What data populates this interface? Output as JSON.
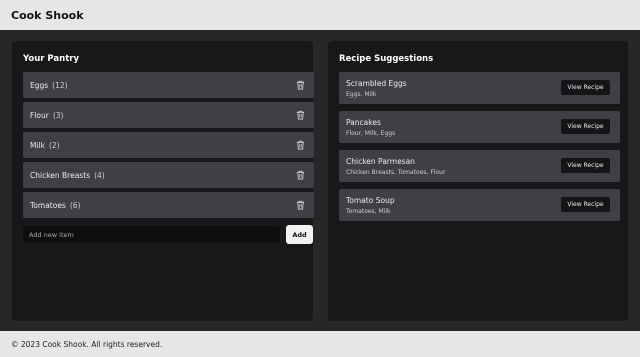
{
  "app": {
    "title": "Cook Shook"
  },
  "pantry": {
    "title": "Your Pantry",
    "items": [
      {
        "name": "Eggs",
        "qty": "(12)"
      },
      {
        "name": "Flour",
        "qty": "(3)"
      },
      {
        "name": "Milk",
        "qty": "(2)"
      },
      {
        "name": "Chicken Breasts",
        "qty": "(4)"
      },
      {
        "name": "Tomatoes",
        "qty": "(6)"
      }
    ],
    "delete_icon": "trash-icon",
    "add_placeholder": "Add new item",
    "add_label": "Add"
  },
  "recipes": {
    "title": "Recipe Suggestions",
    "items": [
      {
        "name": "Scrambled Eggs",
        "ingredients": "Eggs, Milk",
        "button": "View Recipe"
      },
      {
        "name": "Pancakes",
        "ingredients": "Flour, Milk, Eggs",
        "button": "View Recipe"
      },
      {
        "name": "Chicken Parmesan",
        "ingredients": "Chicken Breasts, Tomatoes, Flour",
        "button": "View Recipe"
      },
      {
        "name": "Tomato Soup",
        "ingredients": "Tomatoes, Milk",
        "button": "View Recipe"
      }
    ]
  },
  "footer": {
    "text": "© 2023 Cook Shook. All rights reserved."
  },
  "colors": {
    "background": "#27272a",
    "panel": "#18181b",
    "card": "#3f3f46",
    "header": "#e6e6e6"
  }
}
